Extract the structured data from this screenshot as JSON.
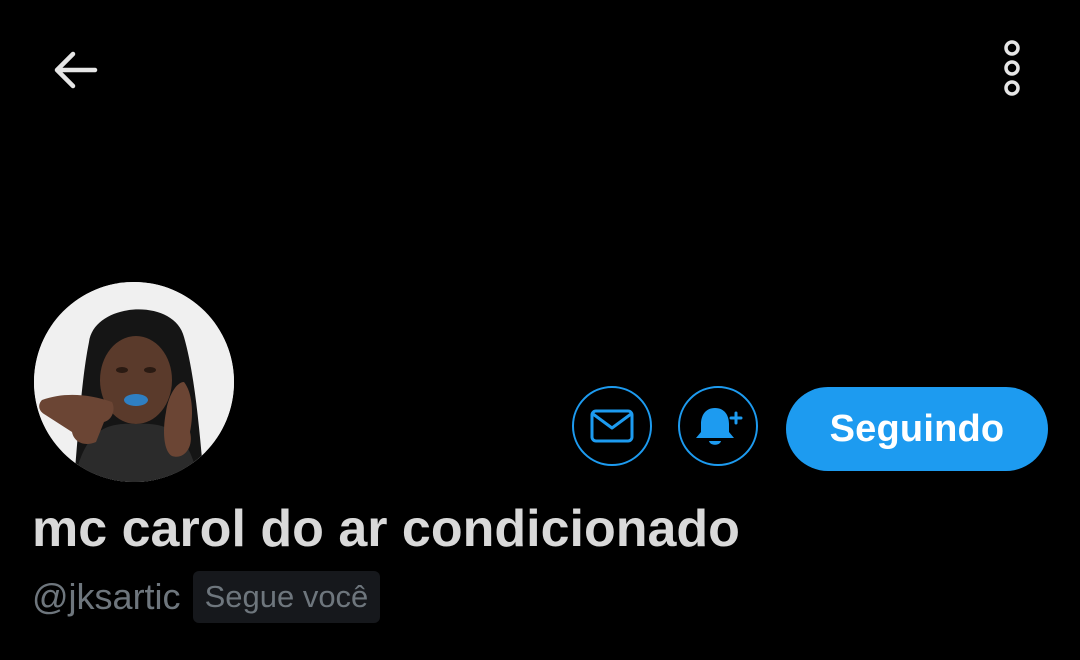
{
  "header": {
    "back_icon": "arrow-left-icon",
    "more_icon": "vertical-ellipsis-icon"
  },
  "profile": {
    "display_name": "mc carol do ar condicionado",
    "handle": "@jksartic",
    "follows_you_badge": "Segue você",
    "avatar_icon": "profile-photo"
  },
  "actions": {
    "message_icon": "envelope-icon",
    "notify_icon": "bell-plus-icon",
    "follow_label": "Seguindo"
  },
  "colors": {
    "background": "#000000",
    "accent": "#1d9bf0",
    "primary_text": "#d9d9d9",
    "secondary_text": "#6e767d",
    "badge_bg": "#16181c"
  }
}
